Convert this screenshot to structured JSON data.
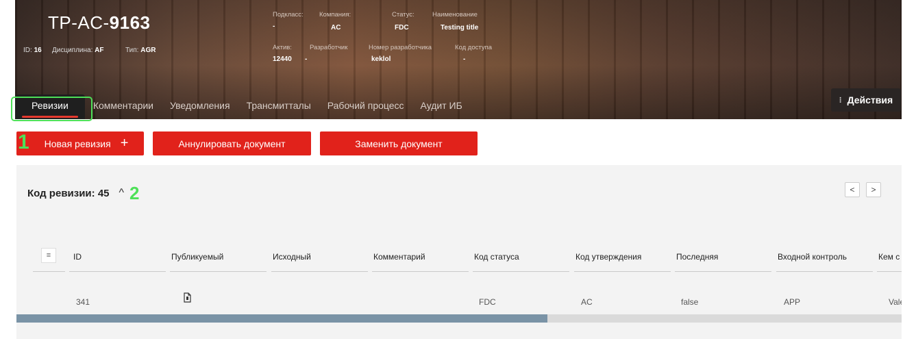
{
  "header": {
    "code_prefix": "TP-AC-",
    "code_number": "9163",
    "id_label": "ID:",
    "id_value": "16",
    "discipline_label": "Дисциплина:",
    "discipline_value": "AF",
    "type_label": "Тип:",
    "type_value": "AGR",
    "fields": [
      {
        "label": "Подкласс:",
        "value": "-"
      },
      {
        "label": "Компания:",
        "value": "AC"
      },
      {
        "label": "Статус:",
        "value": "FDC"
      },
      {
        "label": "Наименование",
        "value": "Testing title"
      },
      {
        "label": "Актив:",
        "value": "12440"
      },
      {
        "label": "Разработчик",
        "value": "-"
      },
      {
        "label": "Номер разработчика",
        "value": "keklol"
      },
      {
        "label": "Код доступа",
        "value": "-"
      }
    ],
    "actions_label": "Действия"
  },
  "tabs": [
    {
      "label": "Ревизии",
      "active": true
    },
    {
      "label": "Комментарии"
    },
    {
      "label": "Уведомления"
    },
    {
      "label": "Трансмитталы"
    },
    {
      "label": "Рабочий процесс"
    },
    {
      "label": "Аудит ИБ"
    }
  ],
  "toolbar": {
    "new_revision": "Новая ревизия",
    "new_revision_plus": "+",
    "cancel_document": "Аннулировать документ",
    "replace_document": "Заменить документ"
  },
  "annotations": {
    "one": "1",
    "two": "2"
  },
  "revision": {
    "title": "Код ревизии: 45",
    "collapse_icon": "^",
    "prev": "<",
    "next": ">"
  },
  "table": {
    "filter_icon": "≡",
    "columns": [
      "ID",
      "Публикуемый",
      "Исходный",
      "Комментарий",
      "Код статуса",
      "Код утверждения",
      "Последняя",
      "Входной контроль",
      "Кем с"
    ],
    "rows": [
      {
        "id": "341",
        "published_icon": "file-icon",
        "source": "",
        "comment": "",
        "status": "FDC",
        "approval": "AC",
        "last": "false",
        "inbound": "APP",
        "by": "Vale"
      }
    ]
  },
  "colors": {
    "accent": "#e1221b",
    "annotation": "#4ee058",
    "scroll_thumb": "#7a93a6"
  }
}
